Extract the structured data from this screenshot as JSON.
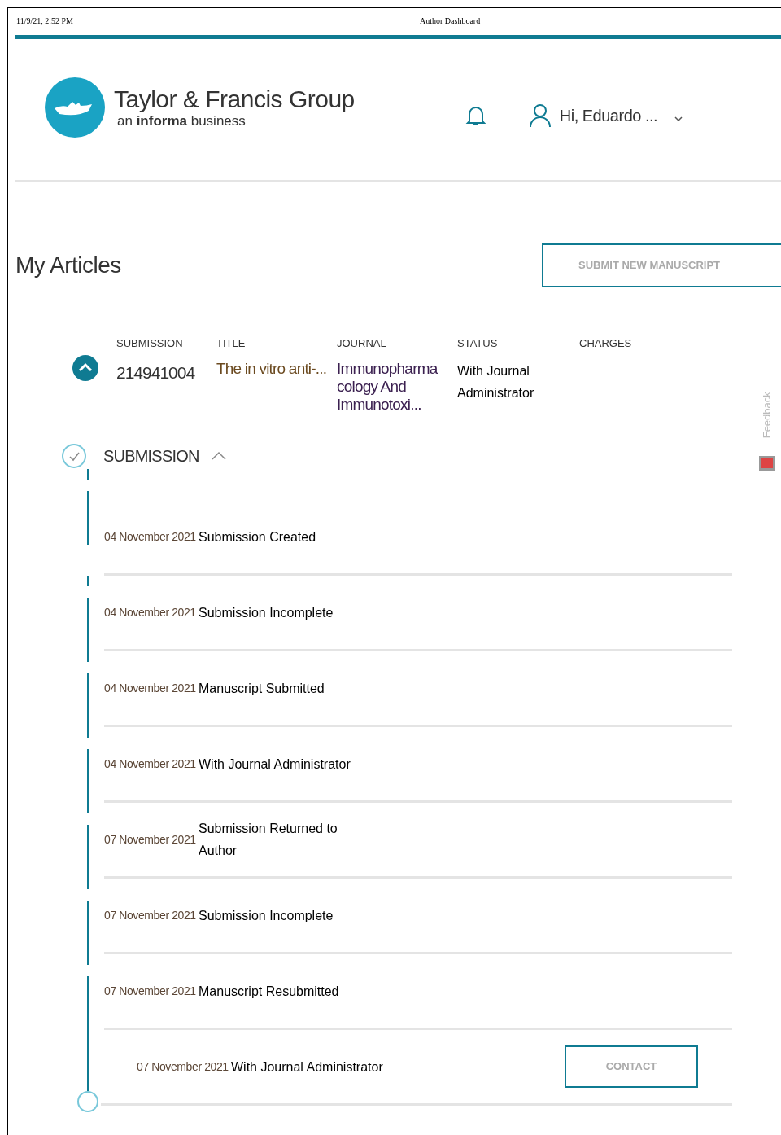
{
  "print_header": {
    "timestamp": "11/9/21, 2:52 PM",
    "page_title": "Author Dashboard"
  },
  "header": {
    "logo_name": "Taylor & Francis Group",
    "logo_tagline": "an **informa** business",
    "greeting": "Hi, Eduardo ..."
  },
  "page_title": "My Articles",
  "submit_button": "SUBMIT NEW MANUSCRIPT",
  "table": {
    "columns": [
      "SUBMISSION",
      "TITLE",
      "JOURNAL",
      "STATUS",
      "CHARGES"
    ],
    "rows": [
      {
        "expanded": true,
        "submission": "214941004",
        "title": "The in vitro anti-...",
        "journal": "Immunopharmacology And Immunotoxi...",
        "status": "With Journal Administrator"
      }
    ]
  },
  "feedback": "Feedback",
  "timeline": {
    "title": "SUBMISSION",
    "expanded": true,
    "events": [
      {
        "date": "04 November 2021",
        "label": "Submission Created",
        "current": false
      },
      {
        "date": "04 November 2021",
        "label": "Submission Incomplete",
        "current": false
      },
      {
        "date": "04 November 2021",
        "label": "Manuscript Submitted",
        "current": false
      },
      {
        "date": "04 November 2021",
        "label": "With Journal Administrator",
        "current": false
      },
      {
        "date": "07 November 2021",
        "label": "Submission Returned to Author",
        "current": false
      },
      {
        "date": "07 November 2021",
        "label": "Submission Incomplete",
        "current": false
      },
      {
        "date": "07 November 2021",
        "label": "Manuscript Resubmitted",
        "current": false
      },
      {
        "date": "07 November 2021",
        "label": "With Journal Administrator",
        "current": true,
        "action": "CONTACT"
      }
    ]
  }
}
